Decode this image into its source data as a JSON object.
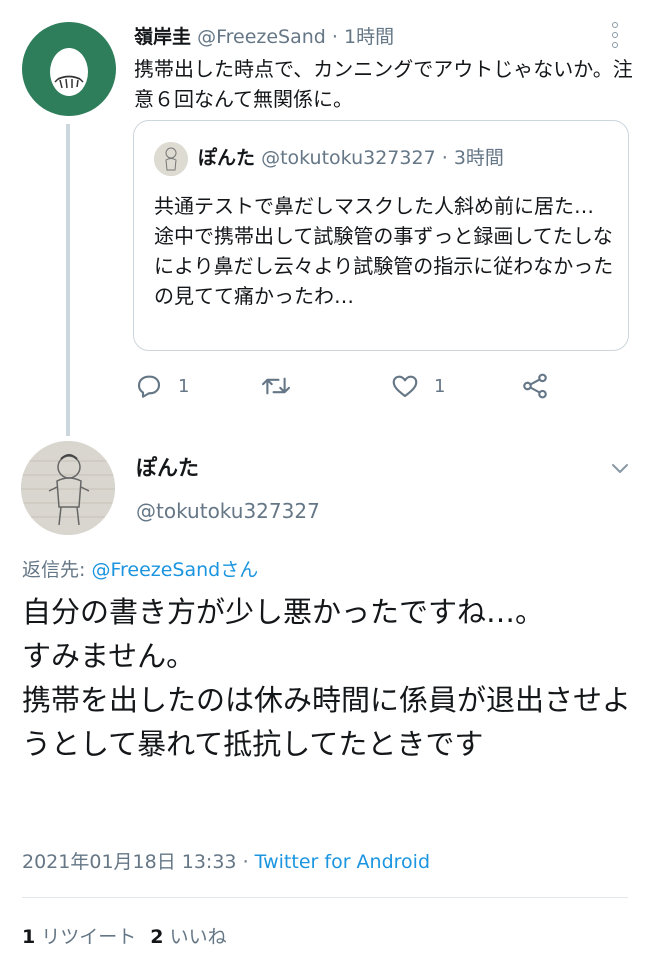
{
  "parent_tweet": {
    "name": "嶺岸圭",
    "handle": "@FreezeSand",
    "separator": "·",
    "time": "1時間",
    "text": "携帯出した時点で、カンニングでアウトじゃないか。注意６回なんて無関係に。",
    "avatar_color": "#2e7d5b"
  },
  "quoted_tweet": {
    "name": "ぽんた",
    "handle": "@tokutoku327327",
    "separator": "·",
    "time": "3時間",
    "text": "共通テストで鼻だしマスクした人斜め前に居た…\n途中で携帯出して試験管の事ずっと録画してたしなにより鼻だし云々より試験管の指示に従わなかったの見てて痛かったわ…"
  },
  "actions": {
    "reply_count": "1",
    "like_count": "1",
    "icons": [
      "reply-icon",
      "retweet-icon",
      "like-icon",
      "share-icon"
    ]
  },
  "main_tweet": {
    "name": "ぽんた",
    "handle": "@tokutoku327327",
    "reply_label": "返信先:",
    "reply_handle": "@FreezeSand",
    "reply_suffix": "さん",
    "text": "自分の書き方が少し悪かったですね…。\nすみません。\n携帯を出したのは休み時間に係員が退出させようとして暴れて抵抗してたときです",
    "date": "2021年01月18日 13:33",
    "separator": "·",
    "source": "Twitter for Android",
    "retweet_count": "1",
    "retweet_label": "リツイート",
    "like_count": "2",
    "like_label": "いいね"
  },
  "colors": {
    "accent": "#1b95e0",
    "muted": "#657786",
    "border": "#ccd6dd"
  }
}
